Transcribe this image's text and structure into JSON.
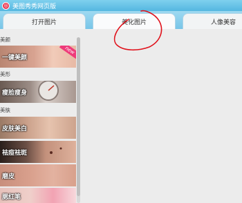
{
  "titlebar": {
    "app_title": "美图秀秀网页版",
    "logo_glyph": "◎"
  },
  "tabs": [
    {
      "label": "打开图片"
    },
    {
      "label": "美化图片"
    },
    {
      "label": "人像美容"
    }
  ],
  "sidebar": {
    "sections": [
      {
        "title": "美颜",
        "items": [
          {
            "label": "一键美颜",
            "badge": "new"
          }
        ]
      },
      {
        "title": "美形",
        "items": [
          {
            "label": "瘦脸瘦身"
          }
        ]
      },
      {
        "title": "美肤",
        "items": [
          {
            "label": "皮肤美白"
          },
          {
            "label": "祛痘祛斑"
          },
          {
            "label": "磨皮"
          },
          {
            "label": "腮红笔"
          }
        ]
      }
    ]
  },
  "colors": {
    "titlebar": "#54b7e0",
    "annotation": "#e0101a",
    "badge": "#ee3a7a"
  }
}
